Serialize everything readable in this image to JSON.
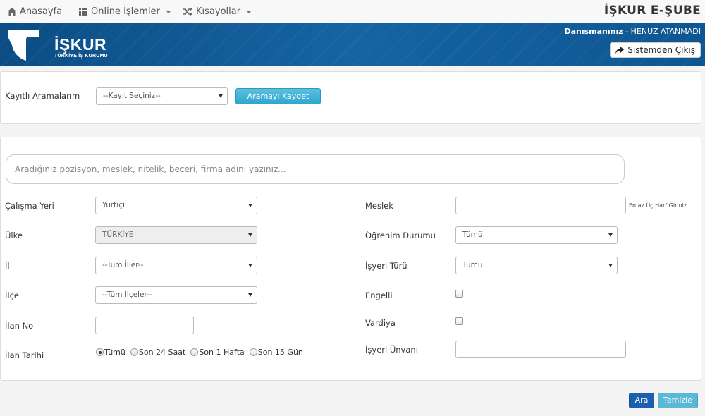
{
  "nav": {
    "home": "Anasayfa",
    "online": "Online İşlemler",
    "shortcuts": "Kısayollar",
    "brand": "İŞKUR E-ŞUBE"
  },
  "header": {
    "logo_title": "İŞKUR",
    "logo_subtitle": "TÜRKİYE İŞ KURUMU",
    "advisor_label": "Danışmanınız",
    "advisor_value": " - HENÜZ ATANMADI",
    "logout": "Sistemden Çıkış"
  },
  "saved": {
    "label": "Kayıtlı Aramalarım",
    "select_value": "--Kayıt Seçiniz--",
    "save_button": "Aramayı Kaydet"
  },
  "search": {
    "placeholder": "Aradığınız pozisyon, meslek, nitelik, beceri, firma adını yazınız..."
  },
  "form": {
    "work_place": {
      "label": "Çalışma Yeri",
      "value": "Yurtiçi"
    },
    "country": {
      "label": "Ülke",
      "value": "TÜRKİYE"
    },
    "province": {
      "label": "İl",
      "value": "--Tüm İller--"
    },
    "district": {
      "label": "İlçe",
      "value": "--Tüm İlçeler--"
    },
    "ad_no": {
      "label": "İlan No",
      "value": ""
    },
    "ad_date": {
      "label": "İlan Tarihi",
      "options": [
        "Tümü",
        "Son 24 Saat",
        "Son 1 Hafta",
        "Son 15 Gün"
      ],
      "selected": "Tümü"
    },
    "profession": {
      "label": "Meslek",
      "value": "",
      "hint": "En az Üç Harf Giriniz."
    },
    "education": {
      "label": "Öğrenim Durumu",
      "value": "Tümü"
    },
    "employer_type": {
      "label": "İşyeri Türü",
      "value": "Tümü"
    },
    "disabled": {
      "label": "Engelli",
      "checked": false
    },
    "shift": {
      "label": "Vardiya",
      "checked": false
    },
    "employer_title": {
      "label": "İşyeri Ünvanı",
      "value": ""
    }
  },
  "actions": {
    "search": "Ara",
    "clear": "Temizle"
  },
  "colors": {
    "header_blue": "#1664a3",
    "info_button": "#5bc0de",
    "primary_button": "#1a5fb0"
  }
}
